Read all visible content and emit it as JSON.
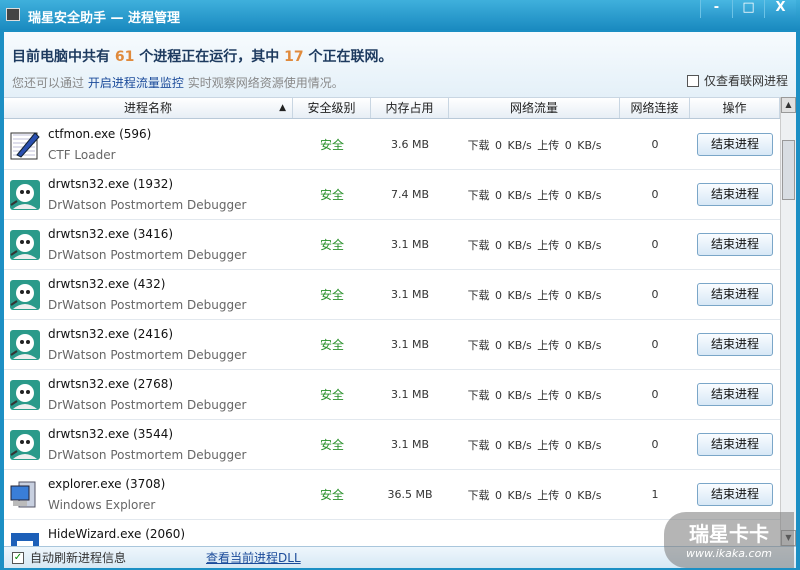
{
  "window": {
    "title": "瑞星安全助手 — 进程管理",
    "minimize": "-",
    "maximize": "□",
    "close": "X"
  },
  "summary": {
    "p1": "目前电脑中共有",
    "total": "61",
    "p2": "个进程正在运行，其中",
    "online": "17",
    "p3": "个正在联网。",
    "hint_pre": "您还可以通过",
    "hint_link": "开启进程流量监控",
    "hint_post": "实时观察网络资源使用情况。",
    "only_net_label": "仅查看联网进程",
    "only_net_checked": false
  },
  "columns": [
    "进程名称",
    "安全级别",
    "内存占用",
    "网络流量",
    "网络连接",
    "操作"
  ],
  "rows": [
    {
      "name": "ctfmon.exe (596)",
      "desc": "CTF Loader",
      "level": "安全",
      "mem": "3.6 MB",
      "net": "下载  0 KB/s   上传  0 KB/s",
      "conn": "0",
      "action": "结束进程",
      "icon": "pen-icon"
    },
    {
      "name": "drwtsn32.exe (1932)",
      "desc": "DrWatson Postmortem Debugger",
      "level": "安全",
      "mem": "7.4 MB",
      "net": "下载  0 KB/s   上传  0 KB/s",
      "conn": "0",
      "action": "结束进程",
      "icon": "doctor-icon"
    },
    {
      "name": "drwtsn32.exe (3416)",
      "desc": "DrWatson Postmortem Debugger",
      "level": "安全",
      "mem": "3.1 MB",
      "net": "下载  0 KB/s   上传  0 KB/s",
      "conn": "0",
      "action": "结束进程",
      "icon": "doctor-icon"
    },
    {
      "name": "drwtsn32.exe (432)",
      "desc": "DrWatson Postmortem Debugger",
      "level": "安全",
      "mem": "3.1 MB",
      "net": "下载  0 KB/s   上传  0 KB/s",
      "conn": "0",
      "action": "结束进程",
      "icon": "doctor-icon"
    },
    {
      "name": "drwtsn32.exe (2416)",
      "desc": "DrWatson Postmortem Debugger",
      "level": "安全",
      "mem": "3.1 MB",
      "net": "下载  0 KB/s   上传  0 KB/s",
      "conn": "0",
      "action": "结束进程",
      "icon": "doctor-icon"
    },
    {
      "name": "drwtsn32.exe (2768)",
      "desc": "DrWatson Postmortem Debugger",
      "level": "安全",
      "mem": "3.1 MB",
      "net": "下载  0 KB/s   上传  0 KB/s",
      "conn": "0",
      "action": "结束进程",
      "icon": "doctor-icon"
    },
    {
      "name": "drwtsn32.exe (3544)",
      "desc": "DrWatson Postmortem Debugger",
      "level": "安全",
      "mem": "3.1 MB",
      "net": "下载  0 KB/s   上传  0 KB/s",
      "conn": "0",
      "action": "结束进程",
      "icon": "doctor-icon"
    },
    {
      "name": "explorer.exe (3708)",
      "desc": "Windows Explorer",
      "level": "安全",
      "mem": "36.5 MB",
      "net": "下载  0 KB/s   上传  0 KB/s",
      "conn": "1",
      "action": "结束进程",
      "icon": "computer-icon"
    },
    {
      "name": "HideWizard.exe (2060)",
      "desc": "",
      "level": "",
      "mem": "",
      "net": "",
      "conn": "",
      "action": "",
      "icon": "window-icon"
    }
  ],
  "status": {
    "auto_refresh": "自动刷新进程信息",
    "auto_refresh_checked": true,
    "dll_link": "查看当前进程DLL"
  },
  "watermark": {
    "brand": "瑞星卡卡",
    "url": "www.ikaka.com"
  }
}
